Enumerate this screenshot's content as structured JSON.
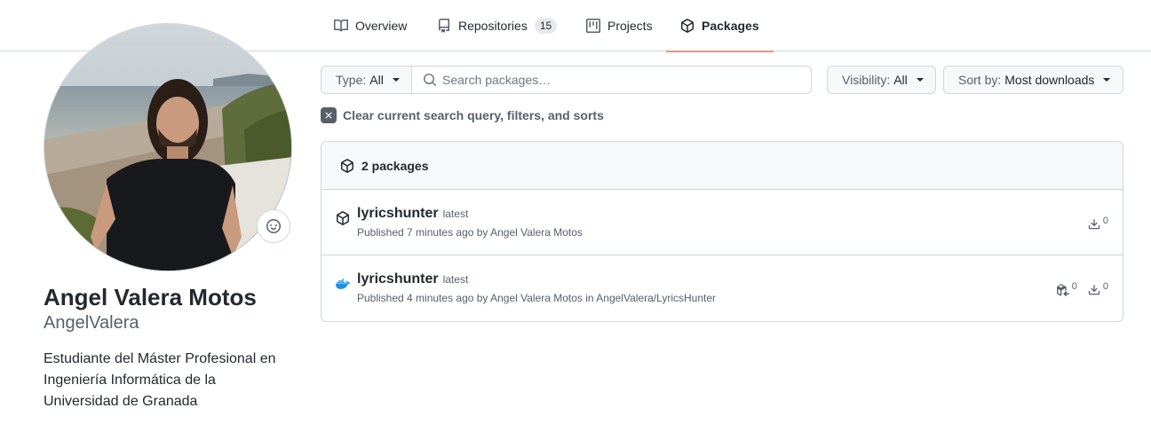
{
  "nav": {
    "tabs": [
      {
        "label": "Overview",
        "icon": "book-icon"
      },
      {
        "label": "Repositories",
        "icon": "repo-icon",
        "count": "15"
      },
      {
        "label": "Projects",
        "icon": "project-icon"
      },
      {
        "label": "Packages",
        "icon": "package-icon",
        "active": true
      }
    ]
  },
  "profile": {
    "name": "Angel Valera Motos",
    "login": "AngelValera",
    "bio": "Estudiante del Máster Profesional en Ingeniería Informática de la Universidad de Granada"
  },
  "filters": {
    "type_label": "Type:",
    "type_value": "All",
    "search_placeholder": "Search packages…",
    "visibility_label": "Visibility:",
    "visibility_value": "All",
    "sort_label": "Sort by:",
    "sort_value": "Most downloads",
    "clear_text": "Clear current search query, filters, and sorts"
  },
  "packages": {
    "header": "2 packages",
    "items": [
      {
        "icon": "package-icon",
        "name": "lyricshunter",
        "tag": "latest",
        "meta": "Published 7 minutes ago by Angel Valera Motos",
        "downloads": "0"
      },
      {
        "icon": "docker-icon",
        "name": "lyricshunter",
        "tag": "latest",
        "meta": "Published 4 minutes ago by Angel Valera Motos in AngelValera/LyricsHunter",
        "dependents": "0",
        "downloads": "0"
      }
    ]
  },
  "colors": {
    "active_tab_underline": "#fd8c73",
    "docker_blue": "#1d91e6"
  }
}
